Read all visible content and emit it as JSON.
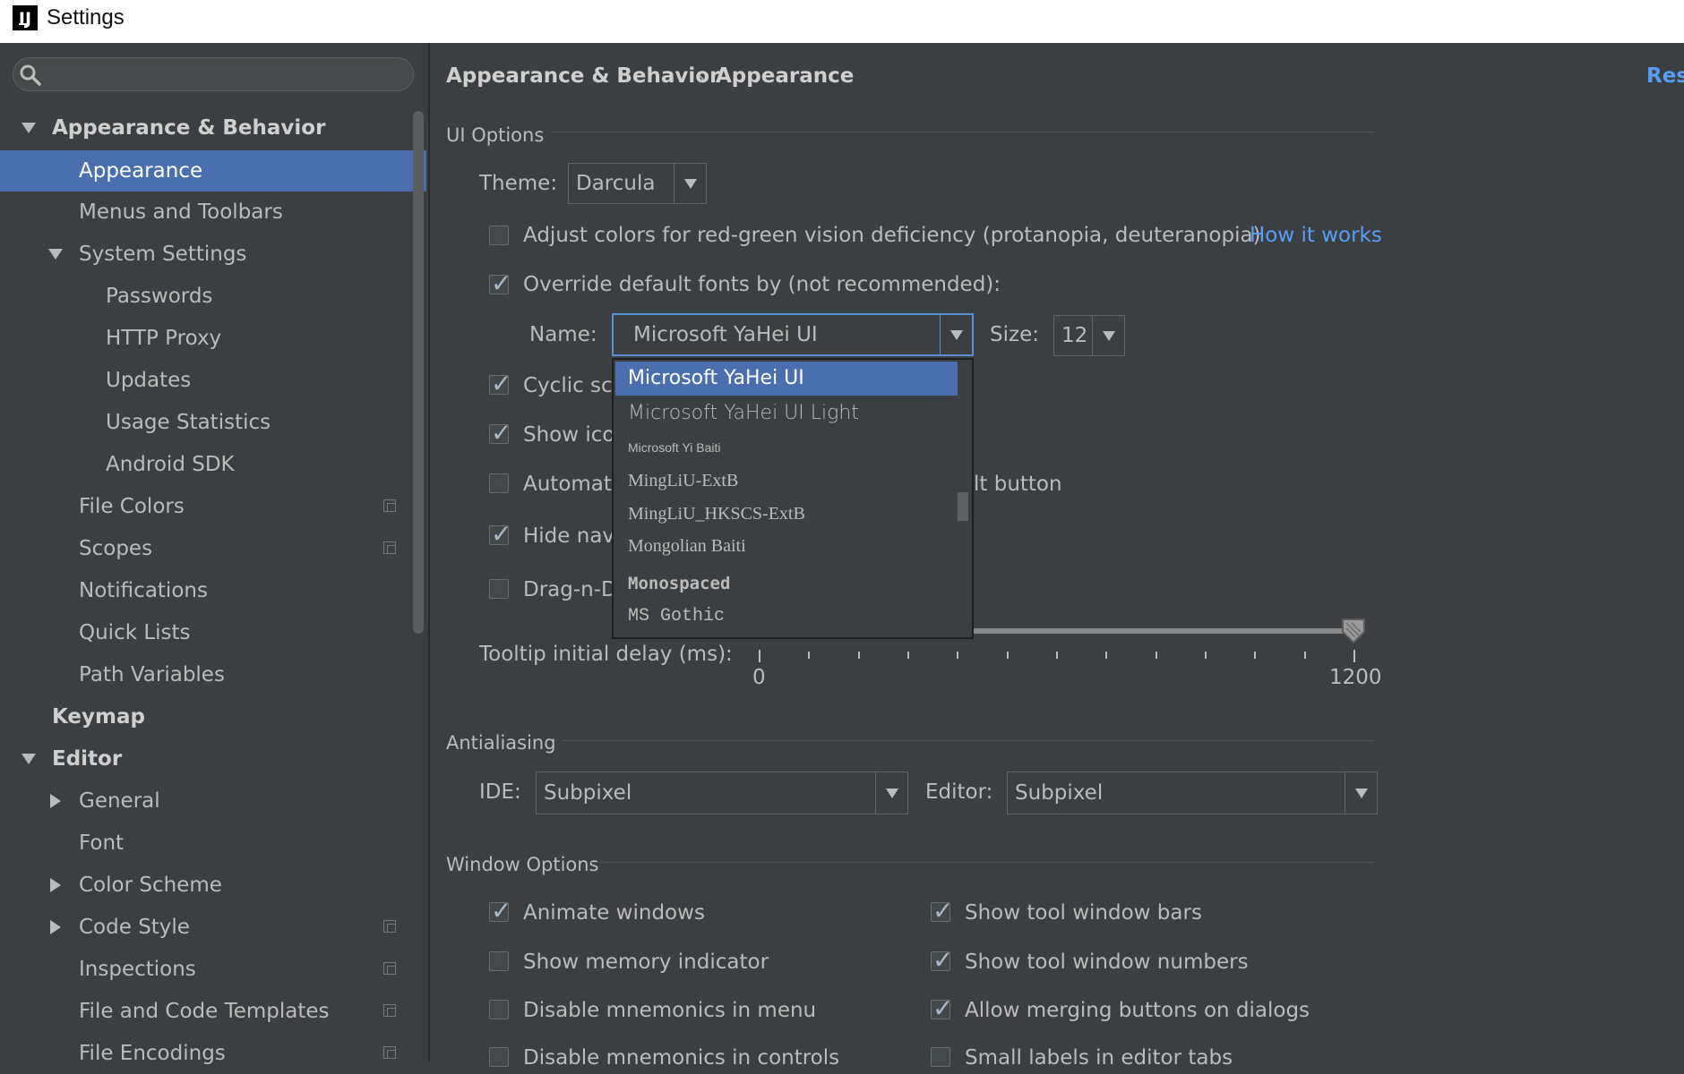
{
  "window": {
    "title": "Settings",
    "logo": "IJ"
  },
  "search": {
    "placeholder": "",
    "value": ""
  },
  "sidebar": {
    "items": [
      {
        "label": "Appearance & Behavior"
      },
      {
        "label": "Appearance"
      },
      {
        "label": "Menus and Toolbars"
      },
      {
        "label": "System Settings"
      },
      {
        "label": "Passwords"
      },
      {
        "label": "HTTP Proxy"
      },
      {
        "label": "Updates"
      },
      {
        "label": "Usage Statistics"
      },
      {
        "label": "Android SDK"
      },
      {
        "label": "File Colors"
      },
      {
        "label": "Scopes"
      },
      {
        "label": "Notifications"
      },
      {
        "label": "Quick Lists"
      },
      {
        "label": "Path Variables"
      },
      {
        "label": "Keymap"
      },
      {
        "label": "Editor"
      },
      {
        "label": "General"
      },
      {
        "label": "Font"
      },
      {
        "label": "Color Scheme"
      },
      {
        "label": "Code Style"
      },
      {
        "label": "Inspections"
      },
      {
        "label": "File and Code Templates"
      },
      {
        "label": "File Encodings"
      }
    ]
  },
  "breadcrumb": {
    "parent": "Appearance & Behavior",
    "separator": "›",
    "current": "Appearance",
    "reset": "Reset"
  },
  "ui_options": {
    "title": "UI Options",
    "theme_label": "Theme:",
    "theme_value": "Darcula",
    "adjust_colors": "Adjust colors for red-green vision deficiency (protanopia, deuteranopia)",
    "how_it_works": "How it works",
    "override_fonts": "Override default fonts by (not recommended):",
    "name_label": "Name:",
    "name_value": "Microsoft YaHei UI",
    "size_label": "Size:",
    "size_value": "12",
    "cyclic": "Cyclic scr",
    "show_icons": "Show ico",
    "automatic": "Automati",
    "automatic_tail": "lt button",
    "hide_nav": "Hide nav",
    "drag_n_drop": "Drag-n-D",
    "tooltip_label": "Tooltip initial delay (ms):",
    "tooltip_min": "0",
    "tooltip_max": "1200",
    "tooltip_value": 1200
  },
  "font_popup": {
    "options": [
      "Microsoft YaHei UI",
      "Microsoft YaHei UI Light",
      "Microsoft Yi Baiti",
      "MingLiU-ExtB",
      "MingLiU_HKSCS-ExtB",
      "Mongolian Baiti",
      "Monospaced",
      "MS Gothic"
    ]
  },
  "antialiasing": {
    "title": "Antialiasing",
    "ide_label": "IDE:",
    "ide_value": "Subpixel",
    "editor_label": "Editor:",
    "editor_value": "Subpixel"
  },
  "window_options": {
    "title": "Window Options",
    "animate_windows": "Animate windows",
    "show_memory": "Show memory indicator",
    "disable_mnemonics_menu": "Disable mnemonics in menu",
    "disable_mnemonics_controls": "Disable mnemonics in controls",
    "show_tool_window_bars": "Show tool window bars",
    "show_tool_window_numbers": "Show tool window numbers",
    "allow_merging": "Allow merging buttons on dialogs",
    "small_labels": "Small labels in editor tabs"
  },
  "colors": {
    "accent": "#4b6eaf",
    "link": "#589df6",
    "background": "#3c3f41"
  }
}
